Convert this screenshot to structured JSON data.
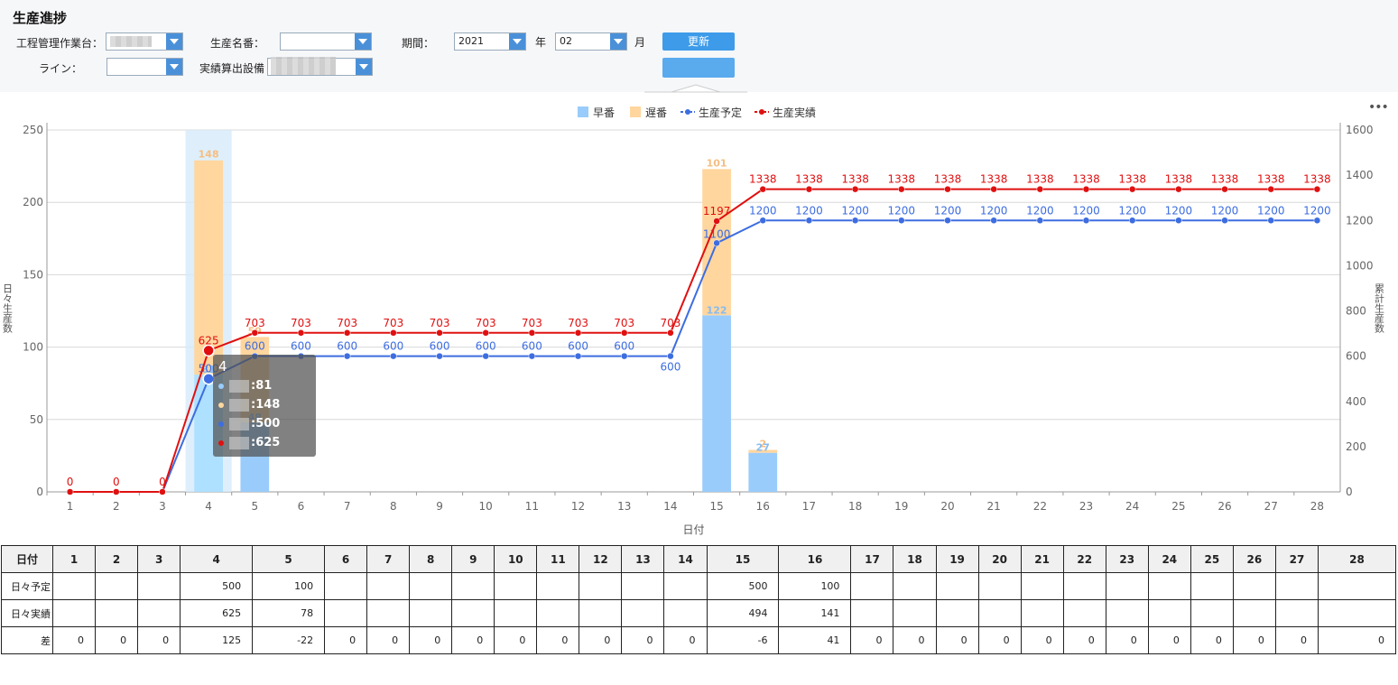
{
  "header": {
    "title": "生産進捗",
    "labels": {
      "process_station": "工程管理作業台：",
      "product_name": "生産名番：",
      "period": "期間：",
      "year_unit": "年",
      "month_unit": "月",
      "line": "ライン：",
      "equipment": "実績算出設備"
    },
    "year_value": "2021",
    "month_value": "02",
    "update_button": "更新"
  },
  "chart_data": {
    "type": "bar",
    "x": [
      1,
      2,
      3,
      4,
      5,
      6,
      7,
      8,
      9,
      10,
      11,
      12,
      13,
      14,
      15,
      16,
      17,
      18,
      19,
      20,
      21,
      22,
      23,
      24,
      25,
      26,
      27,
      28
    ],
    "xlabel": "日付",
    "ylabel_left": "日々生産数",
    "ylabel_right": "累計生産数",
    "ylim_left": [
      0,
      250
    ],
    "ylim_right": [
      0,
      1600
    ],
    "yticks_left": [
      0,
      50,
      100,
      150,
      200,
      250
    ],
    "yticks_right": [
      0,
      200,
      400,
      600,
      800,
      1000,
      1200,
      1400,
      1600
    ],
    "grid": true,
    "legend_position": "top-center",
    "series": [
      {
        "name": "早番",
        "kind": "bar",
        "axis": "left",
        "color": "#99ccfb",
        "values": [
          0,
          0,
          0,
          81,
          48,
          0,
          0,
          0,
          0,
          0,
          0,
          0,
          0,
          0,
          122,
          27,
          0,
          0,
          0,
          0,
          0,
          0,
          0,
          0,
          0,
          0,
          0,
          0
        ]
      },
      {
        "name": "遅番",
        "kind": "bar",
        "axis": "left",
        "color": "#ffd69e",
        "values": [
          0,
          0,
          0,
          148,
          59,
          0,
          0,
          0,
          0,
          0,
          0,
          0,
          0,
          0,
          101,
          2,
          0,
          0,
          0,
          0,
          0,
          0,
          0,
          0,
          0,
          0,
          0,
          0
        ]
      },
      {
        "name": "生産予定",
        "kind": "line",
        "axis": "right",
        "color": "#3d6de0",
        "values": [
          0,
          0,
          0,
          500,
          600,
          600,
          600,
          600,
          600,
          600,
          600,
          600,
          600,
          600,
          1100,
          1200,
          1200,
          1200,
          1200,
          1200,
          1200,
          1200,
          1200,
          1200,
          1200,
          1200,
          1200,
          1200
        ]
      },
      {
        "name": "生産実績",
        "kind": "line",
        "axis": "right",
        "color": "#e01010",
        "values": [
          0,
          0,
          0,
          625,
          703,
          703,
          703,
          703,
          703,
          703,
          703,
          703,
          703,
          703,
          1197,
          1338,
          1338,
          1338,
          1338,
          1338,
          1338,
          1338,
          1338,
          1338,
          1338,
          1338,
          1338,
          1338
        ]
      }
    ],
    "highlight_index": 3,
    "tooltip": {
      "title": "4",
      "rows": [
        {
          "label": "早番",
          "value": "81",
          "color": "#99ccfb"
        },
        {
          "label": "遅番",
          "value": "148",
          "color": "#ffd69e"
        },
        {
          "label": "生産予定",
          "value": "500",
          "color": "#3d6de0"
        },
        {
          "label": "生産実績",
          "value": "625",
          "color": "#e01010"
        }
      ]
    }
  },
  "table": {
    "header_label": "日付",
    "columns": [
      "1",
      "2",
      "3",
      "4",
      "5",
      "6",
      "7",
      "8",
      "9",
      "10",
      "11",
      "12",
      "13",
      "14",
      "15",
      "16",
      "17",
      "18",
      "19",
      "20",
      "21",
      "22",
      "23",
      "24",
      "25",
      "26",
      "27",
      "28"
    ],
    "rows": [
      {
        "label": "日々予定",
        "cells": [
          "",
          "",
          "",
          "500",
          "100",
          "",
          "",
          "",
          "",
          "",
          "",
          "",
          "",
          "",
          "500",
          "100",
          "",
          "",
          "",
          "",
          "",
          "",
          "",
          "",
          "",
          "",
          "",
          ""
        ]
      },
      {
        "label": "日々実績",
        "cells": [
          "",
          "",
          "",
          "625",
          "78",
          "",
          "",
          "",
          "",
          "",
          "",
          "",
          "",
          "",
          "494",
          "141",
          "",
          "",
          "",
          "",
          "",
          "",
          "",
          "",
          "",
          "",
          "",
          ""
        ]
      },
      {
        "label": "差",
        "cells": [
          "0",
          "0",
          "0",
          "125",
          "-22",
          "0",
          "0",
          "0",
          "0",
          "0",
          "0",
          "0",
          "0",
          "0",
          "-6",
          "41",
          "0",
          "0",
          "0",
          "0",
          "0",
          "0",
          "0",
          "0",
          "0",
          "0",
          "0",
          "0"
        ]
      }
    ]
  }
}
